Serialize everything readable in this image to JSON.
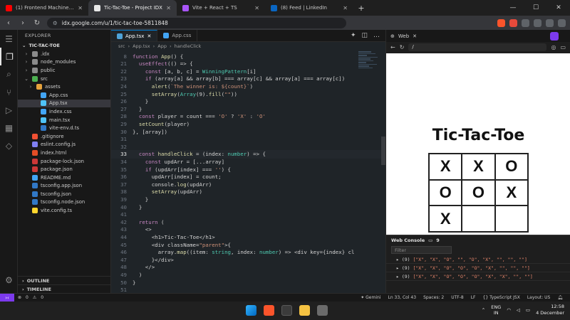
{
  "browser": {
    "tabs": [
      {
        "title": "(1) Frontend Machine Coding Interv",
        "color": "#ff0000",
        "active": false
      },
      {
        "title": "Tic-Tac-Toe - Project IDX",
        "color": "#e8e8e8",
        "active": true
      },
      {
        "title": "Vite + React + TS",
        "color": "#a855f7",
        "active": false
      },
      {
        "title": "(8) Feed | LinkedIn",
        "color": "#0a66c2",
        "active": false
      }
    ],
    "new_tab": "+",
    "url": "idx.google.com/u/1/tic-tac-toe-5811848"
  },
  "explorer": {
    "header": "EXPLORER",
    "project": "TIC-TAC-TOE",
    "items": [
      {
        "label": ".idx",
        "indent": 1,
        "chev": "›",
        "color": "#8b8b8b"
      },
      {
        "label": "node_modules",
        "indent": 1,
        "chev": "›",
        "color": "#8b8b8b"
      },
      {
        "label": "public",
        "indent": 1,
        "chev": "›",
        "color": "#8b8b8b"
      },
      {
        "label": "src",
        "indent": 1,
        "chev": "⌄",
        "color": "#4caf50"
      },
      {
        "label": "assets",
        "indent": 2,
        "chev": "›",
        "color": "#e6a23c"
      },
      {
        "label": "App.css",
        "indent": 3,
        "chev": "",
        "color": "#42a5f5"
      },
      {
        "label": "App.tsx",
        "indent": 3,
        "chev": "",
        "color": "#4fc3f7",
        "selected": true
      },
      {
        "label": "index.css",
        "indent": 3,
        "chev": "",
        "color": "#42a5f5"
      },
      {
        "label": "main.tsx",
        "indent": 3,
        "chev": "",
        "color": "#4fc3f7"
      },
      {
        "label": "vite-env.d.ts",
        "indent": 3,
        "chev": "",
        "color": "#3178c6"
      },
      {
        "label": ".gitignore",
        "indent": 1,
        "chev": "",
        "color": "#f05033"
      },
      {
        "label": "eslint.config.js",
        "indent": 1,
        "chev": "",
        "color": "#8080f2"
      },
      {
        "label": "index.html",
        "indent": 1,
        "chev": "",
        "color": "#e44d26"
      },
      {
        "label": "package-lock.json",
        "indent": 1,
        "chev": "",
        "color": "#cb3837"
      },
      {
        "label": "package.json",
        "indent": 1,
        "chev": "",
        "color": "#cb3837"
      },
      {
        "label": "README.md",
        "indent": 1,
        "chev": "",
        "color": "#42a5f5"
      },
      {
        "label": "tsconfig.app.json",
        "indent": 1,
        "chev": "",
        "color": "#3178c6"
      },
      {
        "label": "tsconfig.json",
        "indent": 1,
        "chev": "",
        "color": "#3178c6"
      },
      {
        "label": "tsconfig.node.json",
        "indent": 1,
        "chev": "",
        "color": "#3178c6"
      },
      {
        "label": "vite.config.ts",
        "indent": 1,
        "chev": "",
        "color": "#ffd62e"
      }
    ],
    "outline": "OUTLINE",
    "timeline": "TIMELINE"
  },
  "editor": {
    "tabs": [
      {
        "label": "App.tsx",
        "active": true
      },
      {
        "label": "App.css",
        "active": false
      }
    ],
    "breadcrumb": [
      "src",
      "App.tsx",
      "App",
      "handleClick"
    ],
    "current_line": "33",
    "lines": [
      {
        "n": "8",
        "t": "function App() {"
      },
      {
        "n": "21",
        "t": "  useEffect(() => {"
      },
      {
        "n": "22",
        "t": "    const [a, b, c] = WinningPattern[i]"
      },
      {
        "n": "23",
        "t": "    if (array[a] && array[b] === array[c] && array[a] === array[c])"
      },
      {
        "n": "24",
        "t": "      alert(`The winner is: ${count}`)"
      },
      {
        "n": "25",
        "t": "      setArray(Array(9).fill(\"\"))"
      },
      {
        "n": "26",
        "t": "    }"
      },
      {
        "n": "27",
        "t": "  }"
      },
      {
        "n": "28",
        "t": "  const player = count === 'O' ? 'X' : 'O'"
      },
      {
        "n": "29",
        "t": "  setCount(player)"
      },
      {
        "n": "30",
        "t": "}, [array])"
      },
      {
        "n": "31",
        "t": ""
      },
      {
        "n": "32",
        "t": ""
      },
      {
        "n": "33",
        "t": "  const handleClick = (index: number) => {"
      },
      {
        "n": "34",
        "t": "    const updArr = [...array]"
      },
      {
        "n": "35",
        "t": "    if (updArr[index] === '') {"
      },
      {
        "n": "36",
        "t": "      updArr[index] = count;"
      },
      {
        "n": "37",
        "t": "      console.log(updArr)"
      },
      {
        "n": "38",
        "t": "      setArray(updArr)"
      },
      {
        "n": "39",
        "t": "    }"
      },
      {
        "n": "40",
        "t": "  }"
      },
      {
        "n": "41",
        "t": ""
      },
      {
        "n": "42",
        "t": "  return ("
      },
      {
        "n": "43",
        "t": "    <>"
      },
      {
        "n": "44",
        "t": "      <h1>Tic-Tac-Toe</h1>"
      },
      {
        "n": "45",
        "t": "      <div className=\"parent\">{"
      },
      {
        "n": "46",
        "t": "        array.map((item: string, index: number) => <div key={index} cl"
      },
      {
        "n": "47",
        "t": "      }</div>"
      },
      {
        "n": "48",
        "t": "    </>"
      },
      {
        "n": "49",
        "t": "  )"
      },
      {
        "n": "50",
        "t": "}"
      },
      {
        "n": "51",
        "t": ""
      }
    ]
  },
  "web": {
    "tab_label": "Web",
    "url_path": "/",
    "page_title": "Tic-Tac-Toe",
    "board": [
      "X",
      "X",
      "O",
      "O",
      "O",
      "X",
      "X",
      "",
      ""
    ],
    "console": {
      "title": "Web Console",
      "count": "9",
      "filter_placeholder": "Filter",
      "lines": [
        {
          "prefix": "▸ (9) ",
          "body": "[\"X\", \"X\", \"O\", \"\", \"O\", \"X\", \"\", \"\", \"\"]"
        },
        {
          "prefix": "▸ (9) ",
          "body": "[\"X\", \"X\", \"O\", \"O\", \"O\", \"X\", \"\", \"\", \"\"]"
        },
        {
          "prefix": "▸ (9) ",
          "body": "[\"X\", \"X\", \"O\", \"O\", \"O\", \"X\", \"X\", \"\", \"\"]"
        }
      ]
    }
  },
  "status": {
    "errors": "0",
    "warnings": "0",
    "gemini": "Gemini",
    "position": "Ln 33, Col 43",
    "spaces": "Spaces: 2",
    "encoding": "UTF-8",
    "eol": "LF",
    "language": "TypeScript JSX",
    "layout": "Layout: US"
  },
  "taskbar": {
    "lang_top": "ENG",
    "lang_bottom": "IN",
    "time": "12:58",
    "date": "4 December"
  }
}
